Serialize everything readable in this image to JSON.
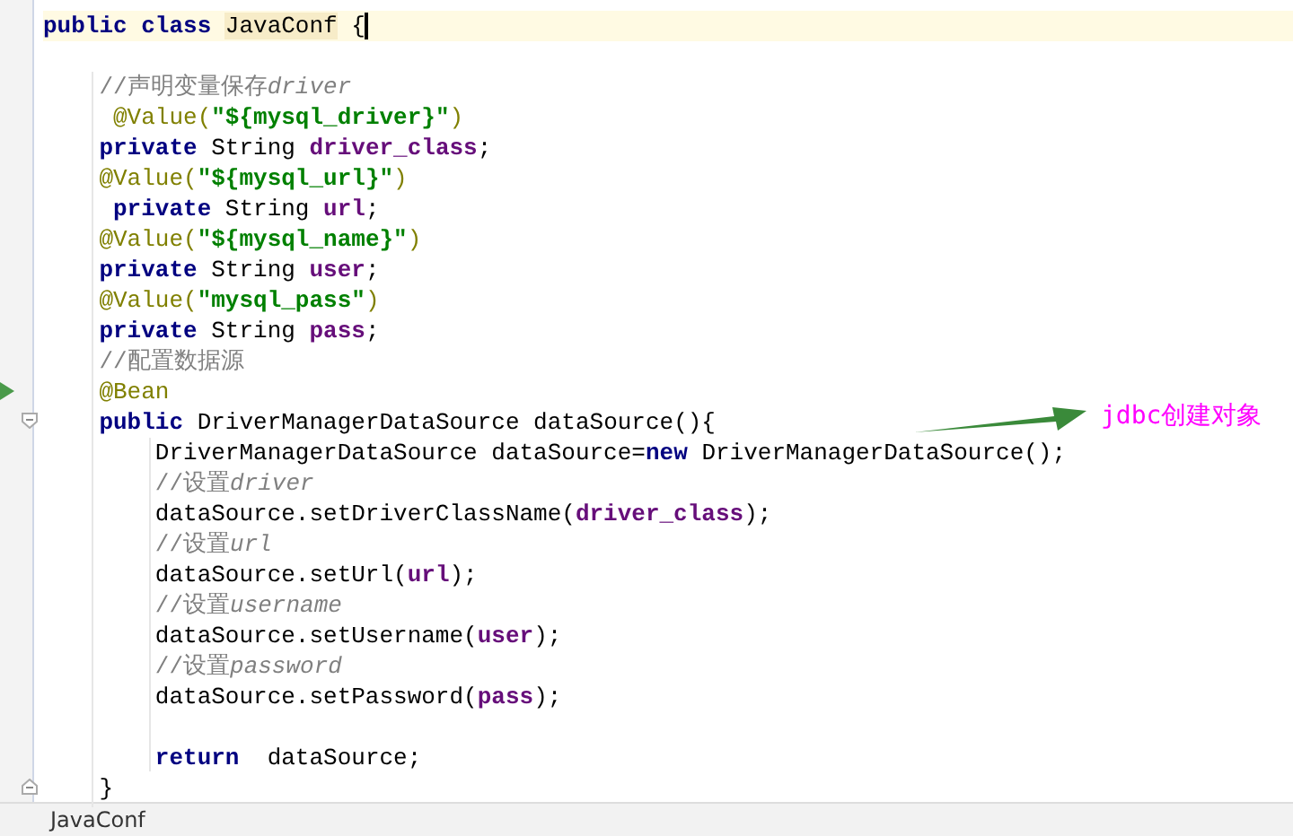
{
  "editor": {
    "lines": [
      {
        "tokens": [
          {
            "t": "public class ",
            "kind": "kw"
          },
          {
            "t": "JavaConf",
            "kind": "hl"
          },
          {
            "t": " {",
            "kind": "brace"
          }
        ],
        "current": true
      },
      {
        "current": false
      },
      {
        "tokens": [
          {
            "t": "    //声明变量保存",
            "kind": "cmtc"
          },
          {
            "t": "driver",
            "kind": "cmt"
          }
        ],
        "current": false
      },
      {
        "tokens": [
          {
            "t": "     @Value(",
            "kind": "ann"
          },
          {
            "t": "\"${mysql_driver}\"",
            "kind": "str"
          },
          {
            "t": ")",
            "kind": "ann"
          }
        ],
        "current": false
      },
      {
        "tokens": [
          {
            "t": "    private ",
            "kind": "kw"
          },
          {
            "t": "String ",
            "kind": "txt"
          },
          {
            "t": "driver_class",
            "kind": "fld"
          },
          {
            "t": ";",
            "kind": "txt"
          }
        ],
        "current": false
      },
      {
        "tokens": [
          {
            "t": "    @Value(",
            "kind": "ann"
          },
          {
            "t": "\"${mysql_url}\"",
            "kind": "str"
          },
          {
            "t": ")",
            "kind": "ann"
          }
        ],
        "current": false
      },
      {
        "tokens": [
          {
            "t": "     private ",
            "kind": "kw"
          },
          {
            "t": "String ",
            "kind": "txt"
          },
          {
            "t": "url",
            "kind": "fld"
          },
          {
            "t": ";",
            "kind": "txt"
          }
        ],
        "current": false
      },
      {
        "tokens": [
          {
            "t": "    @Value(",
            "kind": "ann"
          },
          {
            "t": "\"${mysql_name}\"",
            "kind": "str"
          },
          {
            "t": ")",
            "kind": "ann"
          }
        ],
        "current": false
      },
      {
        "tokens": [
          {
            "t": "    private ",
            "kind": "kw"
          },
          {
            "t": "String ",
            "kind": "txt"
          },
          {
            "t": "user",
            "kind": "fld"
          },
          {
            "t": ";",
            "kind": "txt"
          }
        ],
        "current": false
      },
      {
        "tokens": [
          {
            "t": "    @Value(",
            "kind": "ann"
          },
          {
            "t": "\"mysql_pass\"",
            "kind": "str"
          },
          {
            "t": ")",
            "kind": "ann"
          }
        ],
        "current": false
      },
      {
        "tokens": [
          {
            "t": "    private ",
            "kind": "kw"
          },
          {
            "t": "String ",
            "kind": "txt"
          },
          {
            "t": "pass",
            "kind": "fld"
          },
          {
            "t": ";",
            "kind": "txt"
          }
        ],
        "current": false
      },
      {
        "tokens": [
          {
            "t": "    //配置数据源",
            "kind": "cmtc"
          }
        ],
        "current": false
      },
      {
        "tokens": [
          {
            "t": "    @Bean",
            "kind": "ann"
          }
        ],
        "current": false
      },
      {
        "tokens": [
          {
            "t": "    public ",
            "kind": "kw"
          },
          {
            "t": "DriverManagerDataSource dataSource(){",
            "kind": "txt"
          }
        ],
        "current": false
      },
      {
        "tokens": [
          {
            "t": "        DriverManagerDataSource dataSource=",
            "kind": "txt"
          },
          {
            "t": "new ",
            "kind": "kw"
          },
          {
            "t": "DriverManagerDataSource();",
            "kind": "txt"
          }
        ],
        "current": false
      },
      {
        "tokens": [
          {
            "t": "        //设置",
            "kind": "cmtc"
          },
          {
            "t": "driver",
            "kind": "cmt"
          }
        ],
        "current": false
      },
      {
        "tokens": [
          {
            "t": "        dataSource.setDriverClassName(",
            "kind": "txt"
          },
          {
            "t": "driver_class",
            "kind": "fld"
          },
          {
            "t": ");",
            "kind": "txt"
          }
        ],
        "current": false
      },
      {
        "tokens": [
          {
            "t": "        //设置",
            "kind": "cmtc"
          },
          {
            "t": "url",
            "kind": "cmt"
          }
        ],
        "current": false
      },
      {
        "tokens": [
          {
            "t": "        dataSource.setUrl(",
            "kind": "txt"
          },
          {
            "t": "url",
            "kind": "fld"
          },
          {
            "t": ");",
            "kind": "txt"
          }
        ],
        "current": false
      },
      {
        "tokens": [
          {
            "t": "        //设置",
            "kind": "cmtc"
          },
          {
            "t": "username",
            "kind": "cmt"
          }
        ],
        "current": false
      },
      {
        "tokens": [
          {
            "t": "        dataSource.setUsername(",
            "kind": "txt"
          },
          {
            "t": "user",
            "kind": "fld"
          },
          {
            "t": ");",
            "kind": "txt"
          }
        ],
        "current": false
      },
      {
        "tokens": [
          {
            "t": "        //设置",
            "kind": "cmtc"
          },
          {
            "t": "password",
            "kind": "cmt"
          }
        ],
        "current": false
      },
      {
        "tokens": [
          {
            "t": "        dataSource.setPassword(",
            "kind": "txt"
          },
          {
            "t": "pass",
            "kind": "fld"
          },
          {
            "t": ");",
            "kind": "txt"
          }
        ],
        "current": false
      },
      {
        "current": false
      },
      {
        "tokens": [
          {
            "t": "        return ",
            "kind": "kw"
          },
          {
            "t": " dataSource;",
            "kind": "txt"
          }
        ],
        "current": false
      },
      {
        "tokens": [
          {
            "t": "    }",
            "kind": "txt"
          }
        ],
        "current": false
      }
    ]
  },
  "annotation": {
    "label": "jdbc创建对象"
  },
  "tab_bar": {
    "tab": "JavaConf"
  }
}
